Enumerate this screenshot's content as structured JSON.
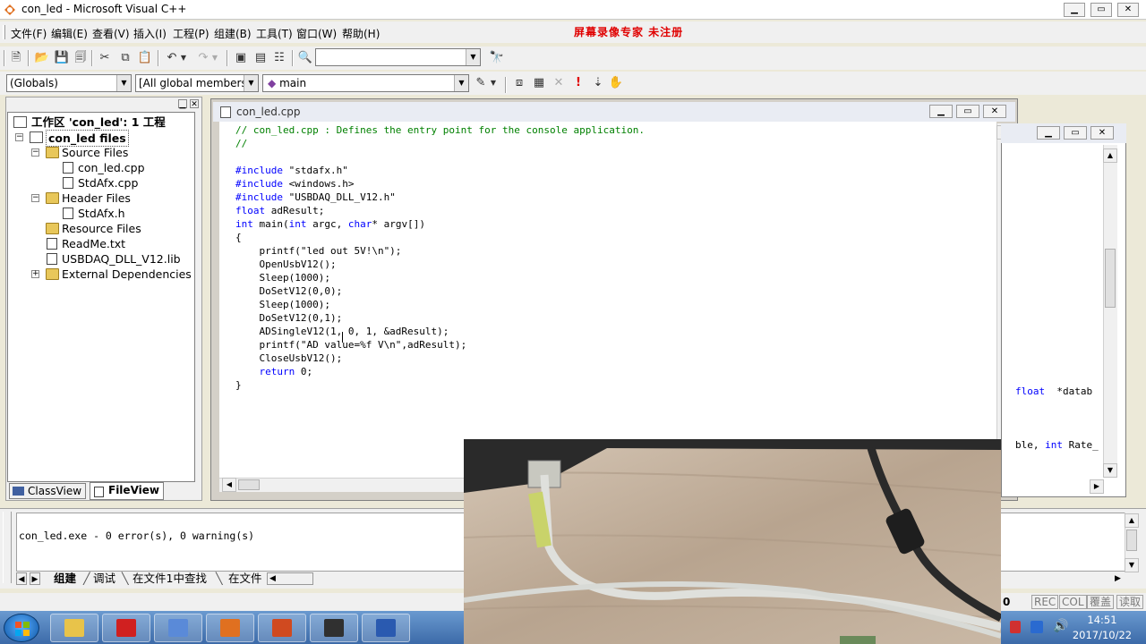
{
  "window": {
    "title": "con_led - Microsoft Visual C++",
    "minimize_glyph": "▁",
    "maximize_glyph": "▭",
    "close_glyph": "✕"
  },
  "menu": [
    {
      "label": "文件(F)"
    },
    {
      "label": "编辑(E)"
    },
    {
      "label": "查看(V)"
    },
    {
      "label": "插入(I)"
    },
    {
      "label": "工程(P)"
    },
    {
      "label": "组建(B)"
    },
    {
      "label": "工具(T)"
    },
    {
      "label": "窗口(W)"
    },
    {
      "label": "帮助(H)"
    }
  ],
  "watermark": "屏幕录像专家 未注册",
  "toolbar": {
    "find_combo_value": "",
    "icons": {
      "new": "🗎",
      "open": "📂",
      "save": "💾",
      "save_all": "🗐",
      "cut": "✂",
      "copy": "⧉",
      "paste": "📋",
      "undo": "↶",
      "redo": "↷",
      "workspace": "▣",
      "output": "▤",
      "window_list": "☷",
      "find_files": "🔍",
      "find": "🔭"
    }
  },
  "wizardbar": {
    "class_combo": "(Globals)",
    "members_combo": "[All global members",
    "function_combo": "main",
    "icons": {
      "actions": "✎",
      "compile": "⧈",
      "build": "▦",
      "stop": "✕",
      "execute": "!",
      "step": "⇣",
      "breakpoint": "✋"
    }
  },
  "workspace": {
    "tree": [
      {
        "label": "工作区 'con_led': 1 工程",
        "level": 0,
        "type": "workspace",
        "expander": ""
      },
      {
        "label": "con_led files",
        "level": 1,
        "type": "project",
        "expander": "−"
      },
      {
        "label": "Source Files",
        "level": 2,
        "type": "folder",
        "expander": "−"
      },
      {
        "label": "con_led.cpp",
        "level": 3,
        "type": "file",
        "expander": ""
      },
      {
        "label": "StdAfx.cpp",
        "level": 3,
        "type": "file",
        "expander": ""
      },
      {
        "label": "Header Files",
        "level": 2,
        "type": "folder",
        "expander": "−"
      },
      {
        "label": "StdAfx.h",
        "level": 3,
        "type": "file",
        "expander": ""
      },
      {
        "label": "Resource Files",
        "level": 2,
        "type": "folder",
        "expander": ""
      },
      {
        "label": "ReadMe.txt",
        "level": 2,
        "type": "file",
        "expander": ""
      },
      {
        "label": "USBDAQ_DLL_V12.lib",
        "level": 2,
        "type": "file",
        "expander": ""
      },
      {
        "label": "External Dependencies",
        "level": 2,
        "type": "folder",
        "expander": "+"
      }
    ],
    "tabs": [
      {
        "label": "ClassView"
      },
      {
        "label": "FileView"
      }
    ]
  },
  "editor": {
    "filename": "con_led.cpp",
    "lines": [
      {
        "kind": "comment",
        "text": "// con_led.cpp : Defines the entry point for the console application."
      },
      {
        "kind": "comment",
        "text": "//"
      },
      {
        "kind": "blank",
        "text": ""
      },
      {
        "kind": "directive",
        "kw": "#include",
        "text": " \"stdafx.h\""
      },
      {
        "kind": "directive",
        "kw": "#include",
        "text": " <windows.h>"
      },
      {
        "kind": "directive",
        "kw": "#include",
        "text": " \"USBDAQ_DLL_V12.h\""
      },
      {
        "kind": "directive",
        "kw": "float",
        "text": " adResult;"
      },
      {
        "kind": "mainsig",
        "kw": "int",
        "a": " main(",
        "kw2": "int",
        "b": " argc, ",
        "kw3": "char",
        "c": "* argv[])"
      },
      {
        "kind": "plain",
        "text": "{"
      },
      {
        "kind": "plain",
        "text": "    printf(\"led out 5V!\\n\");"
      },
      {
        "kind": "plain",
        "text": "    OpenUsbV12();"
      },
      {
        "kind": "plain",
        "text": "    Sleep(1000);"
      },
      {
        "kind": "plain",
        "text": "    DoSetV12(0,0);"
      },
      {
        "kind": "plain",
        "text": "    Sleep(1000);"
      },
      {
        "kind": "plain",
        "text": "    DoSetV12(0,1);"
      },
      {
        "kind": "plain",
        "text": "    ADSingleV12(1, 0, 1, &adResult);"
      },
      {
        "kind": "plain",
        "text": "    printf(\"AD value=%f V\\n\",adResult);"
      },
      {
        "kind": "plain",
        "text": "    CloseUsbV12();"
      },
      {
        "kind": "ret",
        "kw": "return",
        "text": " 0;",
        "indent": "    "
      },
      {
        "kind": "plain",
        "text": "}"
      }
    ]
  },
  "right_pane": {
    "line1": {
      "kw": "float",
      "rest": "  *datab"
    },
    "line2": {
      "pre": "ble, ",
      "kw": "int",
      "rest": " Rate_"
    }
  },
  "output": {
    "message": "con_led.exe - 0 error(s), 0 warning(s)",
    "tabs": [
      {
        "label": "组建"
      },
      {
        "label": "调试"
      },
      {
        "label": "在文件1中查找"
      },
      {
        "label": "在文件"
      }
    ]
  },
  "status": {
    "col": "0",
    "indicators": [
      {
        "label": "REC"
      },
      {
        "label": "COL"
      },
      {
        "label": "覆盖"
      },
      {
        "label": "读取"
      }
    ]
  },
  "taskbar": {
    "time": "14:51",
    "date": "2017/10/22",
    "apps": [
      {
        "icon": "folder-icon",
        "color": "#e8c34a"
      },
      {
        "icon": "acrobat-icon",
        "color": "#d02020"
      },
      {
        "icon": "screen-recorder-icon",
        "color": "#5a8ad8"
      },
      {
        "icon": "visual-cpp-icon",
        "color": "#e07020"
      },
      {
        "icon": "powerpoint-icon",
        "color": "#d04a20"
      },
      {
        "icon": "camera-icon",
        "color": "#303030"
      },
      {
        "icon": "word-icon",
        "color": "#2a5ab0"
      }
    ]
  }
}
